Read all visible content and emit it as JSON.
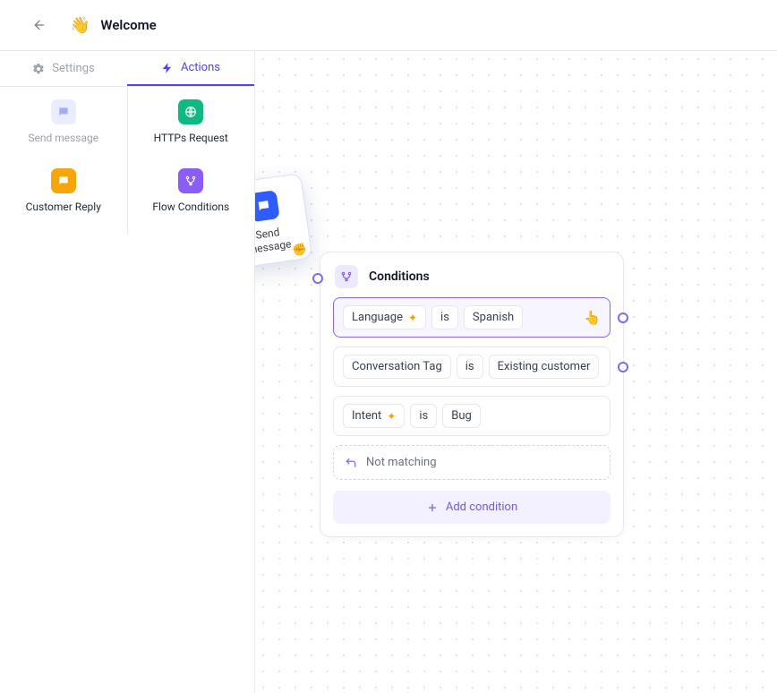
{
  "header": {
    "title": "Welcome",
    "emoji": "👋"
  },
  "tabs": {
    "settings": "Settings",
    "actions": "Actions"
  },
  "palette": {
    "send_message": "Send message",
    "customer_reply": "Customer Reply",
    "https_request": "HTTPs Request",
    "flow_conditions": "Flow Conditions"
  },
  "drag": {
    "label": "Send message"
  },
  "card": {
    "title": "Conditions",
    "rules": [
      {
        "field": "Language",
        "op": "is",
        "value": "Spanish",
        "sparkle": true
      },
      {
        "field": "Conversation Tag",
        "op": "is",
        "value": "Existing customer",
        "sparkle": false
      },
      {
        "field": "Intent",
        "op": "is",
        "value": "Bug",
        "sparkle": true
      }
    ],
    "not_matching": "Not matching",
    "add_condition": "Add condition"
  }
}
